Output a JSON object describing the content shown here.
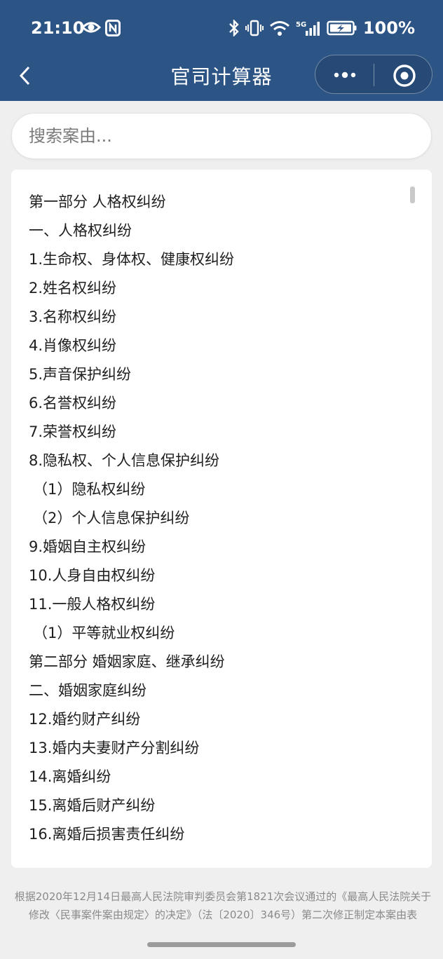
{
  "status_bar": {
    "time": "21:10",
    "battery": "100%",
    "network": "5G"
  },
  "nav": {
    "title": "官司计算器"
  },
  "search": {
    "placeholder": "搜索案由..."
  },
  "items": [
    {
      "text": "第一部分 人格权纠纷",
      "indent": false
    },
    {
      "text": "一、人格权纠纷",
      "indent": false
    },
    {
      "text": "1.生命权、身体权、健康权纠纷",
      "indent": false
    },
    {
      "text": "2.姓名权纠纷",
      "indent": false
    },
    {
      "text": "3.名称权纠纷",
      "indent": false
    },
    {
      "text": "4.肖像权纠纷",
      "indent": false
    },
    {
      "text": "5.声音保护纠纷",
      "indent": false
    },
    {
      "text": "6.名誉权纠纷",
      "indent": false
    },
    {
      "text": "7.荣誉权纠纷",
      "indent": false
    },
    {
      "text": "8.隐私权、个人信息保护纠纷",
      "indent": false
    },
    {
      "text": "（1）隐私权纠纷",
      "indent": true
    },
    {
      "text": "（2）个人信息保护纠纷",
      "indent": true
    },
    {
      "text": "9.婚姻自主权纠纷",
      "indent": false
    },
    {
      "text": "10.人身自由权纠纷",
      "indent": false
    },
    {
      "text": "11.一般人格权纠纷",
      "indent": false
    },
    {
      "text": "（1）平等就业权纠纷",
      "indent": true
    },
    {
      "text": "第二部分 婚姻家庭、继承纠纷",
      "indent": false
    },
    {
      "text": "二、婚姻家庭纠纷",
      "indent": false
    },
    {
      "text": "12.婚约财产纠纷",
      "indent": false
    },
    {
      "text": "13.婚内夫妻财产分割纠纷",
      "indent": false
    },
    {
      "text": "14.离婚纠纷",
      "indent": false
    },
    {
      "text": "15.离婚后财产纠纷",
      "indent": false
    },
    {
      "text": "16.离婚后损害责任纠纷",
      "indent": false
    }
  ],
  "footer": {
    "note": "根据2020年12月14日最高人民法院审判委员会第1821次会议通过的《最高人民法院关于修改〈民事案件案由规定〉的决定》（法〔2020〕346号）第二次修正制定本案由表"
  },
  "colors": {
    "header_bg": "#2c5586",
    "page_bg": "#efefef"
  }
}
